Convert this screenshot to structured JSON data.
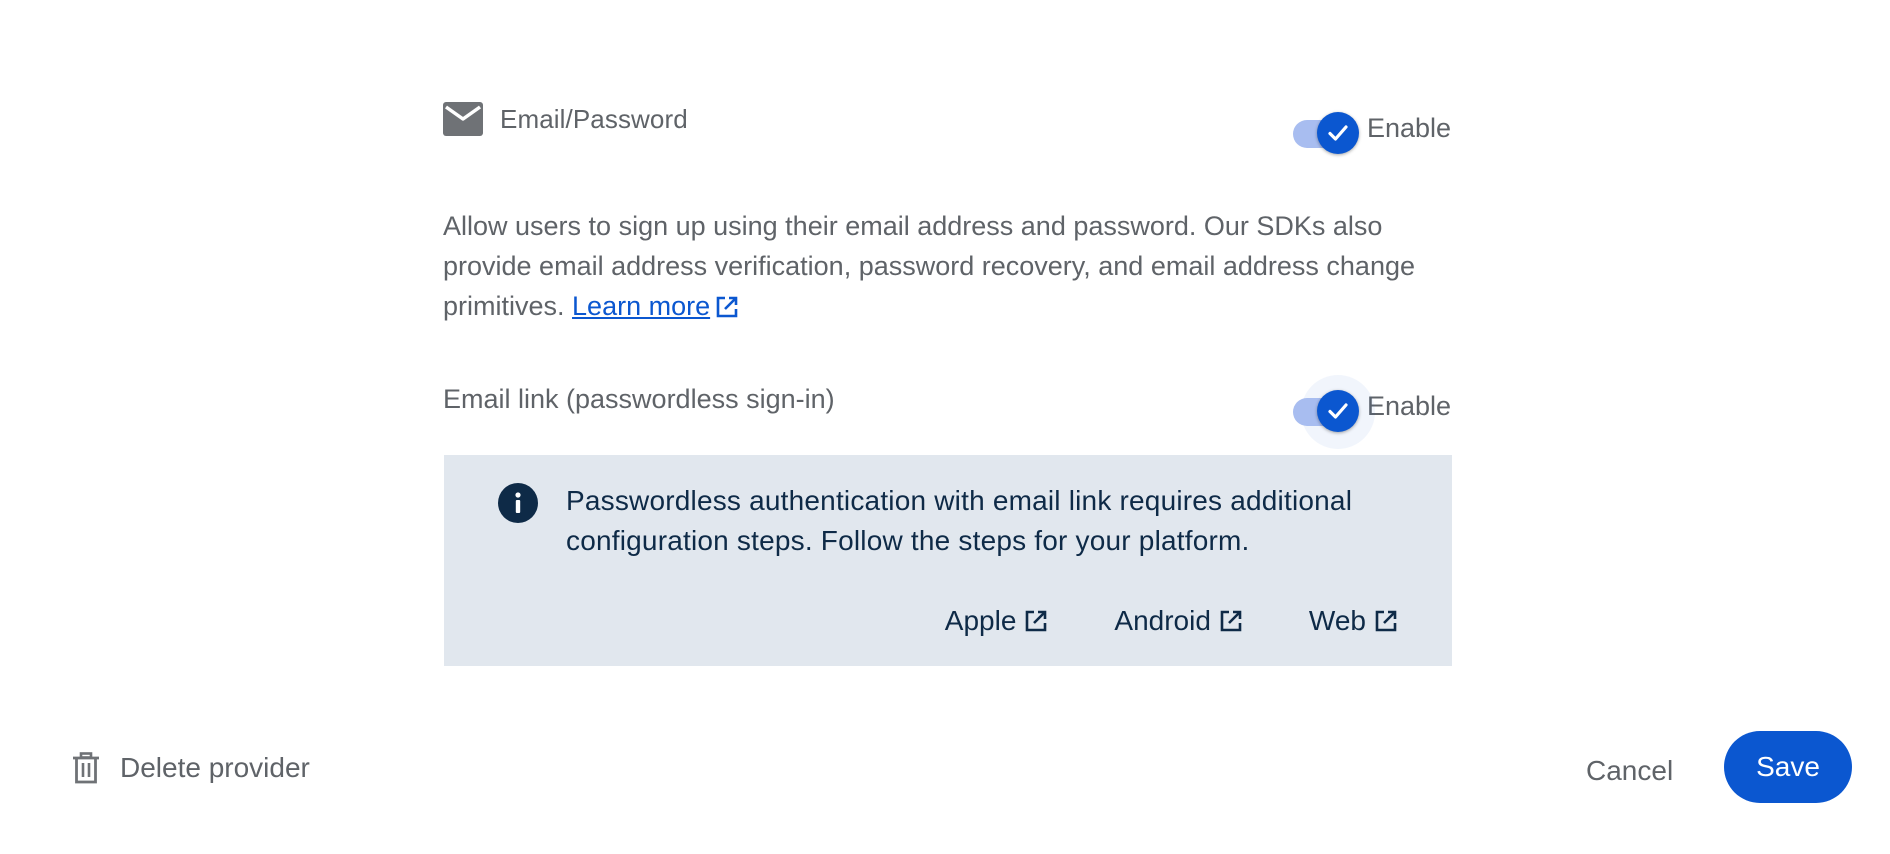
{
  "colors": {
    "accent": "#0b57d0",
    "toggle_track": "#a8bdf0",
    "info_background": "#e1e7ee",
    "info_text": "#0e2a47",
    "secondary_text": "#5f6368"
  },
  "provider": {
    "icon": "email-icon",
    "name": "Email/Password",
    "enabled": true,
    "toggle_label": "Enable"
  },
  "description": {
    "text": "Allow users to sign up using their email address and password. Our SDKs also provide email address verification, password recovery, and email address change primitives.",
    "learn_more_label": "Learn more"
  },
  "email_link": {
    "label": "Email link (passwordless sign-in)",
    "enabled": true,
    "toggle_label": "Enable"
  },
  "info_box": {
    "icon": "info-icon",
    "text": "Passwordless authentication with email link requires additional configuration steps. Follow the steps for your platform.",
    "links": [
      {
        "label": "Apple",
        "icon": "external-link-icon"
      },
      {
        "label": "Android",
        "icon": "external-link-icon"
      },
      {
        "label": "Web",
        "icon": "external-link-icon"
      }
    ]
  },
  "footer": {
    "delete_label": "Delete provider",
    "delete_icon": "trash-icon",
    "cancel_label": "Cancel",
    "save_label": "Save"
  }
}
